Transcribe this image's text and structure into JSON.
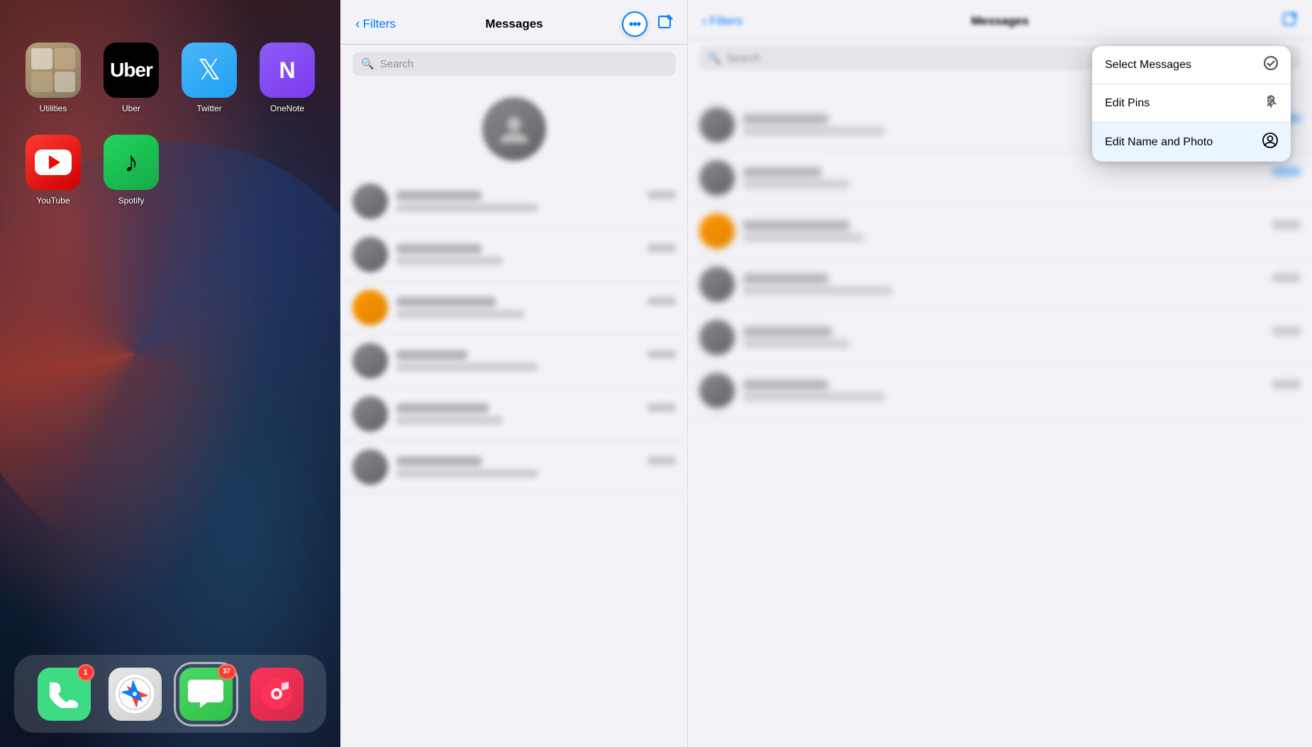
{
  "home_screen": {
    "apps": [
      {
        "id": "utilities",
        "label": "Utilities",
        "emoji": "🔧",
        "bg_class": "app-utilities"
      },
      {
        "id": "uber",
        "label": "Uber",
        "emoji": "🚗",
        "bg_class": "app-uber"
      },
      {
        "id": "twitter",
        "label": "Twitter",
        "emoji": "🐦",
        "bg_class": "app-twitter"
      },
      {
        "id": "onenote",
        "label": "OneNote",
        "emoji": "📓",
        "bg_class": "app-onenote"
      },
      {
        "id": "youtube",
        "label": "YouTube",
        "emoji": "▶",
        "bg_class": "app-youtube"
      },
      {
        "id": "spotify",
        "label": "Spotify",
        "emoji": "🎵",
        "bg_class": "app-spotify"
      }
    ],
    "dock": [
      {
        "id": "phone",
        "label": "Phone",
        "emoji": "📞",
        "bg_class": "app-phone-bg",
        "badge": "1"
      },
      {
        "id": "safari",
        "label": "Safari",
        "emoji": "🧭",
        "bg_class": "app-safari-bg",
        "badge": null
      },
      {
        "id": "messages",
        "label": "Messages",
        "emoji": "💬",
        "bg_class": "app-messages-bg",
        "badge": "37",
        "active": true
      },
      {
        "id": "music",
        "label": "Music",
        "emoji": "🎵",
        "bg_class": "app-music-bg",
        "badge": null
      }
    ]
  },
  "messages_panel": {
    "title": "Messages",
    "filters_label": "Filters",
    "search_placeholder": "Search"
  },
  "dropdown": {
    "items": [
      {
        "id": "select-messages",
        "label": "Select Messages",
        "icon": "✓",
        "highlighted": false
      },
      {
        "id": "edit-pins",
        "label": "Edit Pins",
        "icon": "📌",
        "highlighted": false
      },
      {
        "id": "edit-name-photo",
        "label": "Edit Name and Photo",
        "icon": "👤",
        "highlighted": true
      }
    ]
  }
}
